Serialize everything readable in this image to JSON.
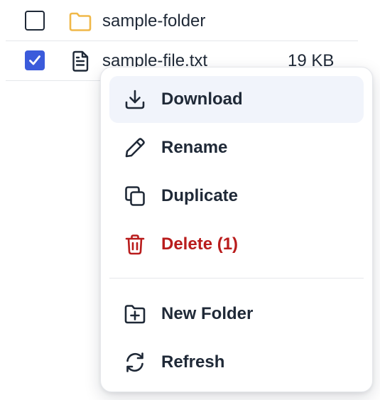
{
  "files": [
    {
      "name": "sample-folder",
      "size": "",
      "type": "folder",
      "checked": false,
      "icon": "folder-icon"
    },
    {
      "name": "sample-file.txt",
      "size": "19 KB",
      "type": "file",
      "checked": true,
      "icon": "file-text-icon"
    }
  ],
  "context_menu": {
    "items": [
      {
        "label": "Download",
        "icon": "download-icon"
      },
      {
        "label": "Rename",
        "icon": "pencil-icon"
      },
      {
        "label": "Duplicate",
        "icon": "copy-icon"
      },
      {
        "label": "Delete (1)",
        "icon": "trash-icon"
      },
      {
        "label": "New Folder",
        "icon": "folder-plus-icon"
      },
      {
        "label": "Refresh",
        "icon": "refresh-icon"
      }
    ]
  },
  "colors": {
    "accent": "#3b5bdb",
    "folder": "#f0b849",
    "danger": "#b91c1c",
    "text": "#1f2937",
    "hover_bg": "#f1f4fb"
  }
}
